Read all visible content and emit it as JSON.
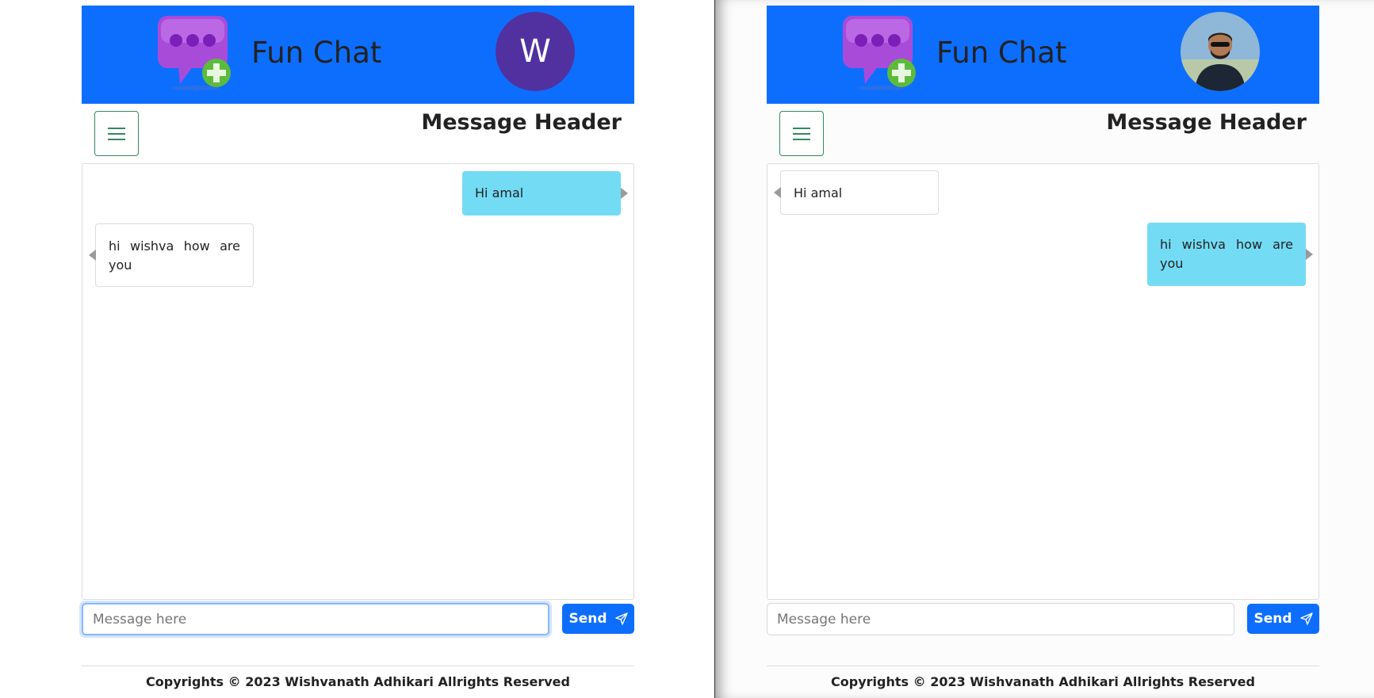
{
  "colors": {
    "header_bg": "#0d6efd",
    "sent_bubble": "#74dbf4",
    "received_bubble": "#ffffff",
    "avatar_bg": "#5131a0",
    "send_button": "#0d6efd",
    "toggle_border": "#2f8a5d"
  },
  "panels": [
    {
      "app_name": "Fun Chat",
      "avatar_letter": "W",
      "message_header": "Message Header",
      "messages": [
        {
          "text": "Hi amal",
          "side": "sent"
        },
        {
          "text": "hi wishva how are you",
          "side": "received"
        }
      ],
      "input_placeholder": "Message here",
      "send_label": "Send",
      "footer": "Copyrights © 2023 Wishvanath Adhikari Allrights Reserved"
    },
    {
      "app_name": "Fun Chat",
      "avatar_image": "profile-photo",
      "message_header": "Message Header",
      "messages": [
        {
          "text": "Hi amal",
          "side": "received"
        },
        {
          "text": "hi wishva how are you",
          "side": "sent"
        }
      ],
      "input_placeholder": "Message here",
      "send_label": "Send",
      "footer": "Copyrights © 2023 Wishvanath Adhikari Allrights Reserved"
    }
  ],
  "icons": {
    "logo": "chat-bubble-plus-icon",
    "menu": "hamburger-icon",
    "send": "paper-plane-icon"
  }
}
